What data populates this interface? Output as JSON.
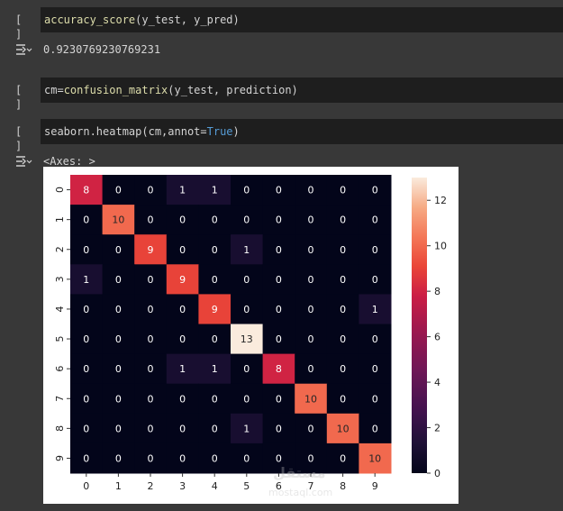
{
  "cells": [
    {
      "run_label": "[ ]",
      "code": {
        "fn": "accuracy_score",
        "args": "(y_test, y_pred)"
      }
    },
    {
      "run_label": "[ ]",
      "code": {
        "prefix": "cm=",
        "fn": "confusion_matrix",
        "args": "(y_test, prediction)"
      }
    },
    {
      "run_label": "[ ]",
      "code": {
        "prefix": "seaborn.heatmap(cm,annot=",
        "kw": "True",
        "suffix": ")"
      }
    }
  ],
  "outputs": {
    "accuracy": "0.9230769230769231",
    "heatmap_repr": "<Axes: >"
  },
  "icons": {
    "run": "run-bracket-icon",
    "output": "output-collapse-icon"
  },
  "colors": {
    "page_bg": "#383838",
    "code_bg": "#1e1e1e",
    "function": "#dcdcaa",
    "keyword": "#569cd6"
  },
  "chart_data": {
    "type": "heatmap",
    "colormap": "rocket",
    "annot": true,
    "x_ticks": [
      "0",
      "1",
      "2",
      "3",
      "4",
      "5",
      "6",
      "7",
      "8",
      "9"
    ],
    "y_ticks": [
      "0",
      "1",
      "2",
      "3",
      "4",
      "5",
      "6",
      "7",
      "8",
      "9"
    ],
    "matrix": [
      [
        8,
        0,
        0,
        1,
        1,
        0,
        0,
        0,
        0,
        0
      ],
      [
        0,
        10,
        0,
        0,
        0,
        0,
        0,
        0,
        0,
        0
      ],
      [
        0,
        0,
        9,
        0,
        0,
        1,
        0,
        0,
        0,
        0
      ],
      [
        1,
        0,
        0,
        9,
        0,
        0,
        0,
        0,
        0,
        0
      ],
      [
        0,
        0,
        0,
        0,
        9,
        0,
        0,
        0,
        0,
        1
      ],
      [
        0,
        0,
        0,
        0,
        0,
        13,
        0,
        0,
        0,
        0
      ],
      [
        0,
        0,
        0,
        1,
        1,
        0,
        8,
        0,
        0,
        0
      ],
      [
        0,
        0,
        0,
        0,
        0,
        0,
        0,
        10,
        0,
        0
      ],
      [
        0,
        0,
        0,
        0,
        0,
        1,
        0,
        0,
        10,
        0
      ],
      [
        0,
        0,
        0,
        0,
        0,
        0,
        0,
        0,
        0,
        10
      ]
    ],
    "colorbar": {
      "range": [
        0,
        13
      ],
      "ticks": [
        0,
        2,
        4,
        6,
        8,
        10,
        12
      ]
    }
  },
  "watermark": {
    "text_ar": "مستقل",
    "text_en": "mostaql.com"
  }
}
